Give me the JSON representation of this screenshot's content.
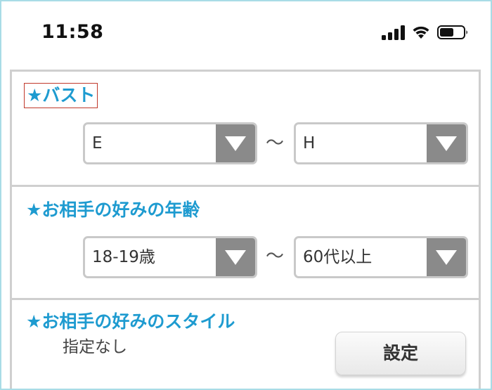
{
  "status_bar": {
    "time": "11:58",
    "icons": [
      "cellular-signal-icon",
      "wifi-icon",
      "battery-icon"
    ]
  },
  "sections": {
    "bust": {
      "title": "★バスト",
      "min_value": "E",
      "separator": "〜",
      "max_value": "H"
    },
    "age": {
      "title": "★お相手の好みの年齢",
      "min_value": "18-19歳",
      "separator": "〜",
      "max_value": "60代以上"
    },
    "style": {
      "title": "★お相手の好みのスタイル",
      "value": "指定なし",
      "button_label": "設定"
    }
  },
  "colors": {
    "title": "#1e9bd0",
    "select_arrow_bg": "#8a8a8a",
    "frame_border": "#a9dce6",
    "highlight_border": "#c0392b"
  }
}
